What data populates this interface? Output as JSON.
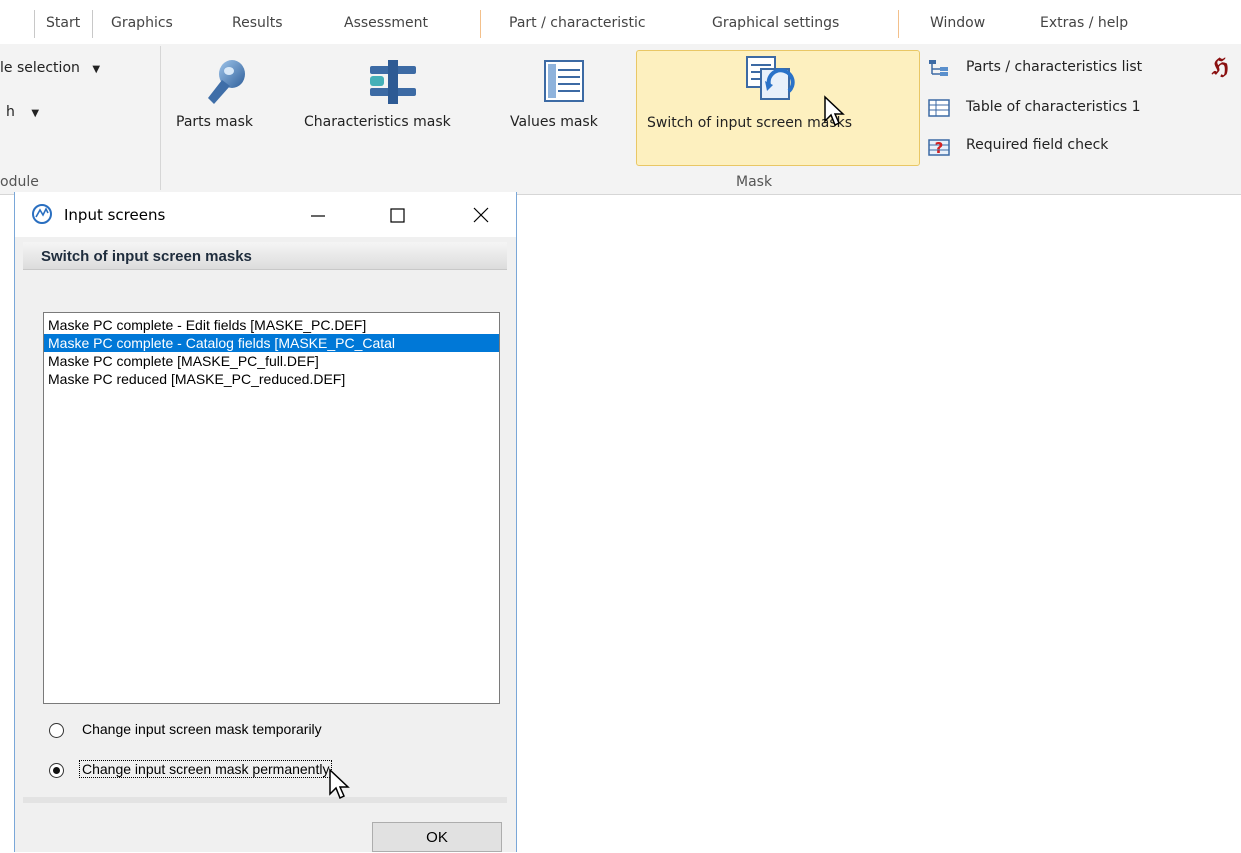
{
  "ribbon": {
    "tabs": [
      {
        "label": "Start"
      },
      {
        "label": "Graphics"
      },
      {
        "label": "Results"
      },
      {
        "label": "Assessment"
      },
      {
        "label": "Part / characteristic"
      },
      {
        "label": "Graphical settings"
      },
      {
        "label": "Window"
      },
      {
        "label": "Extras / help"
      }
    ],
    "left_partial": {
      "item1": "le selection",
      "item2": "h",
      "group_label": "odule"
    },
    "mask_group": {
      "label": "Mask",
      "big_buttons": [
        {
          "label": "Parts mask",
          "icon": "parts-mask-icon"
        },
        {
          "label": "Characteristics mask",
          "icon": "characteristics-mask-icon"
        },
        {
          "label": "Values mask",
          "icon": "values-mask-icon"
        },
        {
          "label": "Switch of input screen masks",
          "icon": "switch-masks-icon"
        }
      ],
      "small_buttons": [
        {
          "label": "Parts / characteristics list",
          "icon": "tree-list-icon"
        },
        {
          "label": "Table of characteristics 1",
          "icon": "table-icon"
        },
        {
          "label": "Required field check",
          "icon": "required-check-icon"
        }
      ],
      "partial_icon": "gothic-h-icon"
    }
  },
  "dialog": {
    "title": "Input screens",
    "header": "Switch of input screen masks",
    "list_items": [
      {
        "label": "Maske PC complete - Edit fields [MASKE_PC.DEF]",
        "selected": false
      },
      {
        "label": "Maske PC complete - Catalog fields [MASKE_PC_Catal",
        "selected": true
      },
      {
        "label": "Maske PC complete [MASKE_PC_full.DEF]",
        "selected": false
      },
      {
        "label": "Maske PC reduced [MASKE_PC_reduced.DEF]",
        "selected": false
      }
    ],
    "radio_options": [
      {
        "label": "Change input screen mask temporarily",
        "checked": false
      },
      {
        "label": "Change input screen mask permanently",
        "checked": true
      }
    ],
    "ok_label": "OK"
  },
  "colors": {
    "selection": "#0078d7",
    "ribbon_bg": "#f3f3f3",
    "highlight_bg": "#fdf0bf",
    "highlight_border": "#e9c765",
    "tab_accent": "#f3c08b"
  }
}
